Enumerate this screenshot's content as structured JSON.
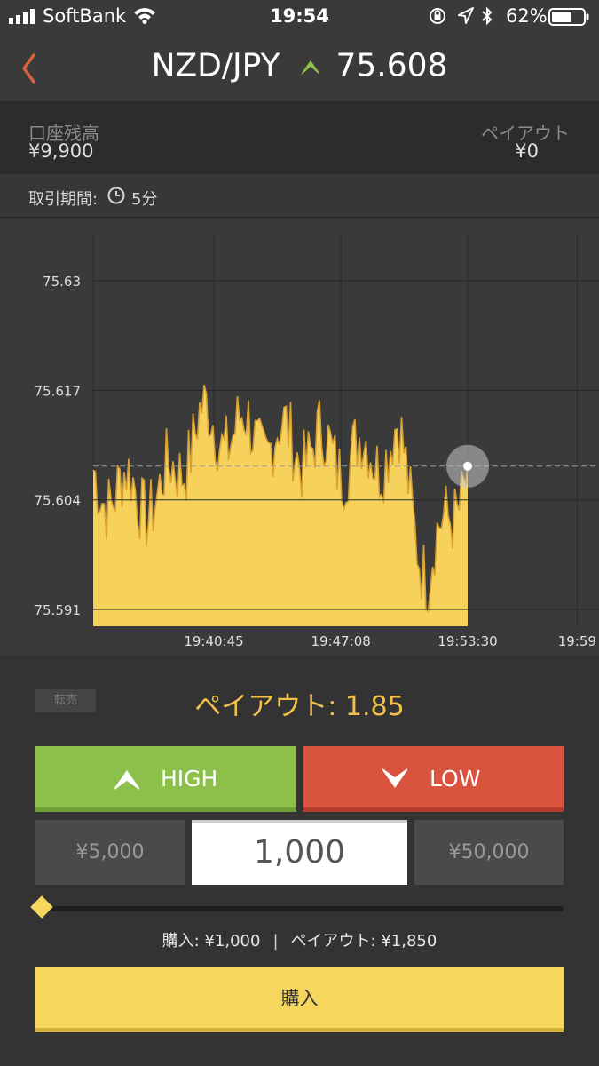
{
  "status_bar": {
    "carrier": "SoftBank",
    "time": "19:54",
    "battery_percent": "62%"
  },
  "header": {
    "pair": "NZD/JPY",
    "rate": "75.608",
    "trend_icon": "up-chevron-icon",
    "accent_color": "#8dc04b"
  },
  "account": {
    "balance_label": "口座残高",
    "balance_value": "¥9,900",
    "payout_label": "ペイアウト",
    "payout_value": "¥0"
  },
  "period": {
    "label": "取引期間:",
    "value": "5分"
  },
  "chart_data": {
    "type": "area",
    "color": "#f6d15c",
    "y_ticks": [
      "75.63",
      "75.617",
      "75.604",
      "75.591"
    ],
    "x_ticks": [
      "19:40:45",
      "19:47:08",
      "19:53:30",
      "19:59"
    ],
    "ylim": [
      75.589,
      75.6375
    ],
    "current_value": 75.608,
    "x": [
      "19:36:00",
      "19:38:00",
      "19:40:00",
      "19:42:00",
      "19:44:00",
      "19:46:00",
      "19:48:00",
      "19:50:00",
      "19:51:30",
      "19:53:30"
    ],
    "series": [
      {
        "values": [
          75.606,
          75.604,
          75.613,
          75.612,
          75.611,
          75.61,
          75.609,
          75.611,
          75.595,
          75.608
        ]
      }
    ]
  },
  "trade": {
    "resell_label": "転売",
    "payout_rate": "ペイアウト: 1.85",
    "high_label": "HIGH",
    "low_label": "LOW",
    "amount_min": "¥5,000",
    "amount_value": "1,000",
    "amount_max": "¥50,000",
    "slider_fraction": 0.0,
    "summary_purchase": "購入: ¥1,000",
    "summary_payout": "ペイアウト: ¥1,850",
    "buy_label": "購入"
  }
}
